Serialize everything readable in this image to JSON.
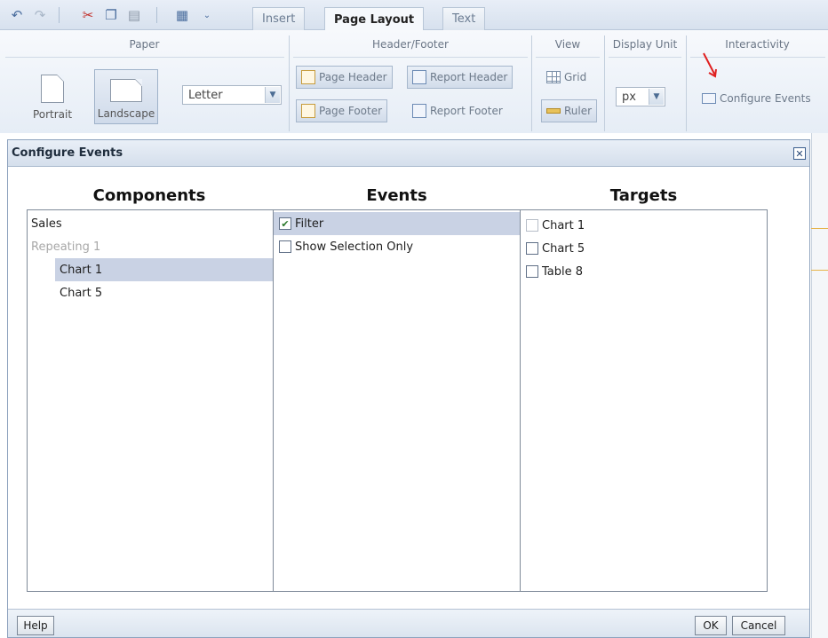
{
  "ribbon": {
    "tabs": [
      {
        "label": "Insert"
      },
      {
        "label": "Page Layout"
      },
      {
        "label": "Text"
      }
    ],
    "groups": {
      "paper": {
        "title": "Paper",
        "portrait": "Portrait",
        "landscape": "Landscape",
        "size_value": "Letter"
      },
      "header_footer": {
        "title": "Header/Footer",
        "page_header": "Page Header",
        "report_header": "Report Header",
        "page_footer": "Page Footer",
        "report_footer": "Report Footer"
      },
      "view": {
        "title": "View",
        "grid": "Grid",
        "ruler": "Ruler"
      },
      "display_unit": {
        "title": "Display Unit",
        "value": "px"
      },
      "interactivity": {
        "title": "Interactivity",
        "configure_events": "Configure Events"
      }
    },
    "icons": [
      "undo-icon",
      "redo-icon",
      "cut-icon",
      "copy-icon",
      "paste-icon",
      "format-icon",
      "dropdown-icon"
    ]
  },
  "dialog": {
    "title": "Configure Events",
    "columns": {
      "components": "Components",
      "events": "Events",
      "targets": "Targets"
    },
    "components": [
      {
        "label": "Sales",
        "indent": 0,
        "state": "normal"
      },
      {
        "label": "Repeating 1",
        "indent": 0,
        "state": "dim"
      },
      {
        "label": "Chart 1",
        "indent": 1,
        "state": "selected"
      },
      {
        "label": "Chart 5",
        "indent": 1,
        "state": "normal"
      }
    ],
    "events": [
      {
        "label": "Filter",
        "checked": true,
        "selected": true
      },
      {
        "label": "Show Selection Only",
        "checked": false,
        "selected": false
      }
    ],
    "targets": [
      {
        "label": "Chart 1",
        "checked": false,
        "disabled": true
      },
      {
        "label": "Chart 5",
        "checked": false,
        "disabled": false
      },
      {
        "label": "Table 8",
        "checked": false,
        "disabled": false
      }
    ],
    "buttons": {
      "help": "Help",
      "ok": "OK",
      "cancel": "Cancel"
    }
  },
  "colors": {
    "accent_arrow": "#e02020",
    "selection": "#c9d2e4"
  }
}
